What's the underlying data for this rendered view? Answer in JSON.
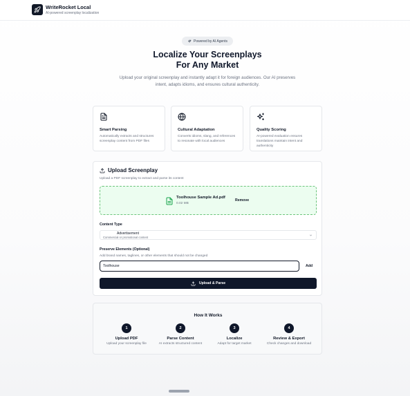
{
  "header": {
    "app_title": "WriteRocket Local",
    "app_subtitle": "AI-powered screenplay localization"
  },
  "hero": {
    "badge": "Powered by AI Agents",
    "title_line1": "Localize Your Screenplays",
    "title_line2": "For Any Market",
    "description": "Upload your original screenplay and instantly adapt it for foreign audiences. Our AI preserves intent, adapts idioms, and ensures cultural authenticity."
  },
  "features": [
    {
      "icon": "document-icon",
      "title": "Smart Parsing",
      "description": "Automatically extracts and structures screenplay content from PDF files"
    },
    {
      "icon": "globe-icon",
      "title": "Cultural Adaptation",
      "description": "Converts idioms, slang, and references to resonate with local audiences"
    },
    {
      "icon": "sparkles-icon",
      "title": "Quality Scoring",
      "description": "AI-powered evaluation ensures translations maintain intent and authenticity"
    }
  ],
  "upload": {
    "title": "Upload Screenplay",
    "subtitle": "Upload a PDF screenplay to extract and parse its content",
    "file_name": "Toolhouse Sample Ad.pdf",
    "file_size": "0.02 MB",
    "remove_label": "Remove",
    "content_type_label": "Content Type",
    "content_type_value": "Advertisement",
    "content_type_desc": "Commercial or promotional content",
    "preserve_label": "Preserve Elements (Optional)",
    "preserve_hint": "Add brand names, taglines, or other elements that should not be changed",
    "preserve_value": "Toolhouse",
    "add_label": "Add",
    "submit_label": "Upload & Parse"
  },
  "how": {
    "title": "How It Works",
    "steps": [
      {
        "num": "1",
        "title": "Upload PDF",
        "desc": "Upload your screenplay file"
      },
      {
        "num": "2",
        "title": "Parse Content",
        "desc": "AI extracts structured content"
      },
      {
        "num": "3",
        "title": "Localize",
        "desc": "Adapt for target market"
      },
      {
        "num": "4",
        "title": "Review & Export",
        "desc": "Check changes and download"
      }
    ]
  },
  "colors": {
    "primary": "#0f172a",
    "dropzone_bg": "#ecfdf0",
    "dropzone_border": "#6bc47a",
    "file_icon": "#16a34a"
  }
}
